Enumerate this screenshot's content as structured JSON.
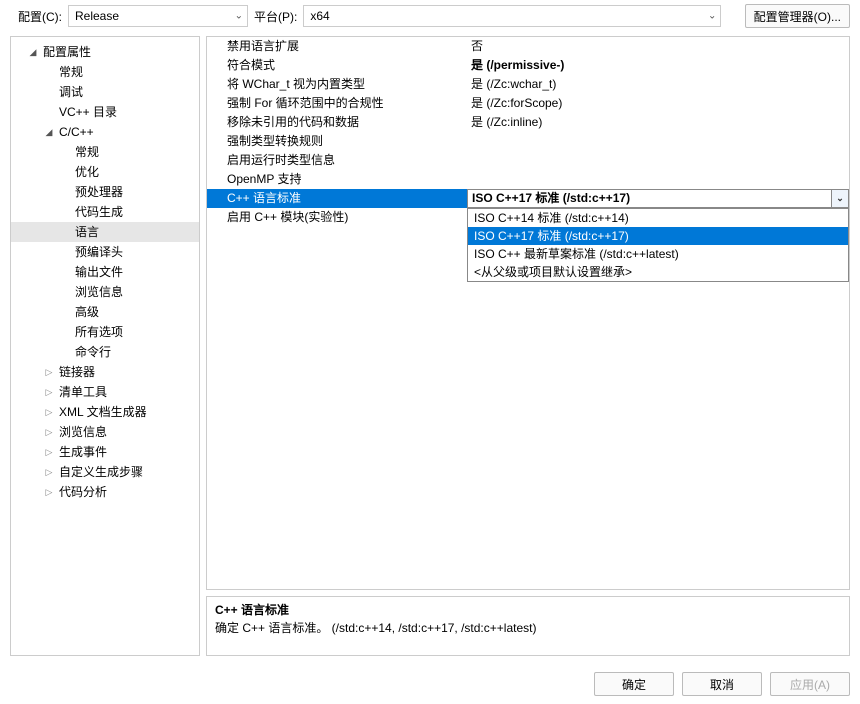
{
  "topbar": {
    "config_label": "配置(C):",
    "config_value": "Release",
    "platform_label": "平台(P):",
    "platform_value": "x64",
    "manager_btn": "配置管理器(O)..."
  },
  "tree": {
    "root": "配置属性",
    "lvl1": {
      "general": "常规",
      "debug": "调试",
      "vc_dirs": "VC++ 目录",
      "ccpp": "C/C++",
      "linker": "链接器",
      "manifest": "清单工具",
      "xmldoc": "XML 文档生成器",
      "browse": "浏览信息",
      "build_events": "生成事件",
      "custom_build": "自定义生成步骤",
      "code_analysis": "代码分析"
    },
    "ccpp_children": {
      "general": "常规",
      "optimize": "优化",
      "preproc": "预处理器",
      "codegen": "代码生成",
      "language": "语言",
      "pch": "预编译头",
      "output": "输出文件",
      "browseinfo": "浏览信息",
      "advanced": "高级",
      "all_options": "所有选项",
      "cmdline": "命令行"
    }
  },
  "props": {
    "rows": [
      {
        "k": "禁用语言扩展",
        "v": "否"
      },
      {
        "k": "符合模式",
        "v": "是 (/permissive-)",
        "bold": true
      },
      {
        "k": "将 WChar_t 视为内置类型",
        "v": "是 (/Zc:wchar_t)"
      },
      {
        "k": "强制 For 循环范围中的合规性",
        "v": "是 (/Zc:forScope)"
      },
      {
        "k": "移除未引用的代码和数据",
        "v": "是 (/Zc:inline)"
      },
      {
        "k": "强制类型转换规则",
        "v": ""
      },
      {
        "k": "启用运行时类型信息",
        "v": ""
      },
      {
        "k": "OpenMP 支持",
        "v": ""
      },
      {
        "k": "C++ 语言标准",
        "v": "ISO C++17 标准 (/std:c++17)",
        "active": true
      },
      {
        "k": "启用 C++ 模块(实验性)",
        "v": ""
      }
    ]
  },
  "dropdown": {
    "options": [
      "ISO C++14 标准 (/std:c++14)",
      "ISO C++17 标准 (/std:c++17)",
      "ISO C++ 最新草案标准 (/std:c++latest)",
      "<从父级或项目默认设置继承>"
    ],
    "selected_index": 1
  },
  "desc": {
    "title": "C++ 语言标准",
    "text": "确定 C++ 语言标准。     (/std:c++14, /std:c++17, /std:c++latest)"
  },
  "buttons": {
    "ok": "确定",
    "cancel": "取消",
    "apply": "应用(A)"
  }
}
